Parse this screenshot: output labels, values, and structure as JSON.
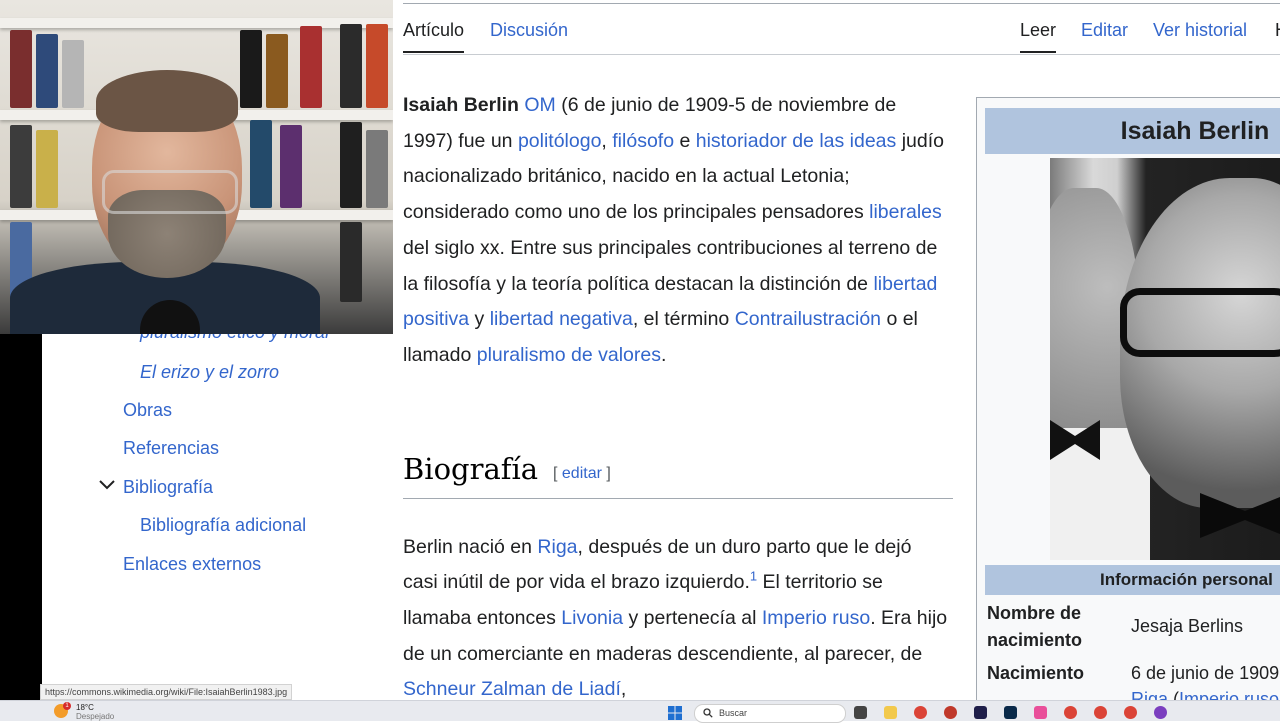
{
  "toc": {
    "partial_item": "pluralismo ético y moral",
    "items": [
      {
        "label": "El erizo y el zorro",
        "italic": true
      },
      {
        "label": "Obras"
      },
      {
        "label": "Referencias"
      },
      {
        "label": "Bibliografía"
      },
      {
        "label": "Bibliografía adicional"
      },
      {
        "label": "Enlaces externos"
      }
    ]
  },
  "status_bar": {
    "url": "https://commons.wikimedia.org/wiki/File:IsaiahBerlin1983.jpg"
  },
  "tabs": {
    "article": "Artículo",
    "discussion": "Discusión",
    "read": "Leer",
    "edit": "Editar",
    "history": "Ver historial",
    "more": "H"
  },
  "intro": {
    "name": "Isaiah Berlin",
    "om": "OM",
    "t1": " (6 de junio de 1909-5 de noviembre de 1997) fue un ",
    "politologo": "politólogo",
    "t2": ", ",
    "filosofo": "filósofo",
    "t3": " e ",
    "historiador": "historiador de las ideas",
    "t4": " judío nacionalizado británico, nacido en la actual Letonia; considerado como uno de los principales pensadores ",
    "liberales": "liberales",
    "t5": " del siglo xx. Entre sus principales contribuciones al terreno de la filosofía y la teoría política destacan la distinción de ",
    "libertad_positiva": "libertad positiva",
    "t6": " y ",
    "libertad_negativa": "libertad negativa",
    "t7": ", el término ",
    "contrailustracion": "Contrailustración",
    "t8": " o el llamado ",
    "pluralismo": "pluralismo de valores",
    "t9": "."
  },
  "section": {
    "title": "Biografía",
    "edit_open": "[ ",
    "edit": "editar",
    "edit_close": " ]"
  },
  "bio": {
    "t1": "Berlin nació en ",
    "riga": "Riga",
    "t2": ", después de un duro parto que le dejó casi inútil de por vida el brazo izquierdo.",
    "ref": "1",
    "t3": " El territorio se llamaba entonces ",
    "livonia": "Livonia",
    "t4": " y pertenecía al ",
    "imperio": "Imperio ruso",
    "t5": ". Era hijo de un comerciante en maderas descendiente, al parecer, de ",
    "schneur": "Schneur Zalman de Liadí",
    "t6": ","
  },
  "infobox": {
    "title": "Isaiah Berlin",
    "section": "Información personal",
    "rows": [
      {
        "label": "Nombre de nacimiento",
        "value": "Jesaja Berlins"
      },
      {
        "label": "Nacimiento",
        "value": "6 de junio de 1909",
        "value2_link1": "Riga",
        "value2_sep": " (",
        "value2_link2": "Imperio ruso"
      }
    ]
  },
  "taskbar": {
    "weather_temp": "18°C",
    "weather_desc": "Despejado",
    "weather_badge": "1",
    "search_label": "Buscar"
  },
  "colors": {
    "link": "#3366cc",
    "infobox_header": "#b0c4de",
    "text": "#202122"
  }
}
